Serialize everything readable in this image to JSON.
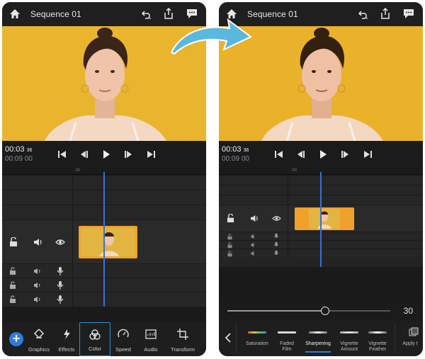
{
  "colors": {
    "accent": "#2f7ce0",
    "playhead": "#3a6fd8",
    "clip": "#f0a12b",
    "video_bg": "#e9b52f",
    "arrow": "#5ab8df"
  },
  "before": {
    "title": "Sequence 01",
    "timecode_main": "00:03",
    "timecode_frames": "36",
    "timecode_total": "00:09",
    "timecode_total_frames": "00",
    "ruler_label": ":00",
    "tools": [
      {
        "label": "Graphics",
        "icon": "graphics-icon"
      },
      {
        "label": "Effects",
        "icon": "effects-icon"
      },
      {
        "label": "Color",
        "icon": "color-icon",
        "selected": true
      },
      {
        "label": "Speed",
        "icon": "speed-icon"
      },
      {
        "label": "Audio",
        "icon": "audio-icon"
      },
      {
        "label": "Transform",
        "icon": "transform-icon"
      }
    ]
  },
  "after": {
    "title": "Sequence 01",
    "timecode_main": "00:03",
    "timecode_frames": "36",
    "timecode_total": "00:09",
    "timecode_total_frames": "00",
    "ruler_label": ":00",
    "slider_value": "30",
    "slider_fraction": 0.6,
    "adjustments": [
      {
        "label": "Saturation",
        "swatch": "saturation-swatch"
      },
      {
        "label": "Faded Film",
        "swatch": "faded-film-swatch"
      },
      {
        "label": "Sharpening",
        "swatch": "sharpening-swatch",
        "selected": true
      },
      {
        "label": "Vignette Amount",
        "swatch": "vignette-amount-swatch"
      },
      {
        "label": "Vignette Feather",
        "swatch": "vignette-feather-swatch"
      },
      {
        "label": "Apply t",
        "swatch": "apply-icon"
      }
    ]
  }
}
